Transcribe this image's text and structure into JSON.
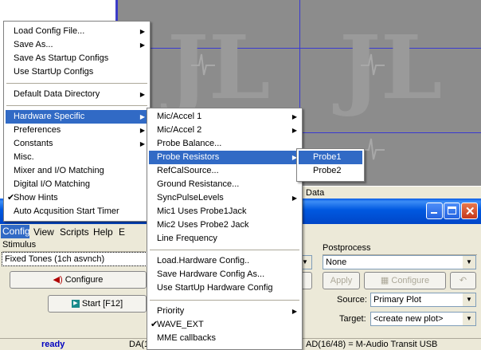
{
  "colors": {
    "menu_highlight": "#316ac5",
    "plot_bg": "#8c8c8c",
    "grid": "#3a3ad0",
    "xp_title": "#0058e0"
  },
  "plot": {
    "watermark": "JL"
  },
  "data_tab": {
    "label": "Data"
  },
  "window": {
    "controls": {
      "minimize": "minimize-icon",
      "maximize": "maximize-icon",
      "close": "close-icon"
    }
  },
  "menubar": {
    "items": [
      "Config",
      "View",
      "Scripts",
      "Help",
      "E"
    ]
  },
  "stimulus": {
    "label": "Stimulus",
    "value": "Fixed Tones (1ch asvnch)",
    "configure_label": "Configure",
    "start_label": "Start [F12]"
  },
  "postprocess": {
    "label": "Postprocess",
    "value": "None",
    "apply_label": "Apply",
    "configure_label": "Configure",
    "source_label": "Source:",
    "source_value": "Primary Plot",
    "target_label": "Target:",
    "target_value": "<create new plot>"
  },
  "status": {
    "ready": "ready",
    "da": "DA(1",
    "ad": "AD(16/48) = M-Audio Transit USB"
  },
  "config_menu": {
    "items": [
      {
        "label": "Load Config File...",
        "sub": true
      },
      {
        "label": "Save As...",
        "sub": true
      },
      {
        "label": "Save As Startup Configs"
      },
      {
        "label": "Use StartUp Configs"
      },
      {
        "label": "Default Data Directory",
        "sub": true
      },
      {
        "label": "Hardware Specific",
        "sub": true,
        "highlight": true
      },
      {
        "label": "Preferences",
        "sub": true
      },
      {
        "label": "Constants",
        "sub": true
      },
      {
        "label": "Misc."
      },
      {
        "label": "Mixer and I/O Matching"
      },
      {
        "label": "Digital I/O Matching"
      },
      {
        "label": "Show Hints",
        "checked": true
      },
      {
        "label": "Auto Acqusition Start Timer"
      }
    ]
  },
  "hardware_menu": {
    "items": [
      {
        "label": "Mic/Accel 1",
        "sub": true
      },
      {
        "label": "Mic/Accel 2",
        "sub": true
      },
      {
        "label": "Probe Balance..."
      },
      {
        "label": "Probe Resistors",
        "sub": true,
        "highlight": true
      },
      {
        "label": "RefCalSource..."
      },
      {
        "label": "Ground Resistance..."
      },
      {
        "label": "SyncPulseLevels",
        "sub": true
      },
      {
        "label": "Mic1 Uses Probe1Jack"
      },
      {
        "label": "Mic2 Uses Probe2 Jack"
      },
      {
        "label": "Line Frequency"
      },
      {
        "label": "Load.Hardware Config.."
      },
      {
        "label": "Save Hardware Config As..."
      },
      {
        "label": "Use StartUp Hardware Config"
      },
      {
        "label": "Priority",
        "sub": true
      },
      {
        "label": "WAVE_EXT",
        "checked": true
      },
      {
        "label": "MME callbacks"
      }
    ]
  },
  "probe_menu": {
    "items": [
      {
        "label": "Probe1",
        "highlight": true
      },
      {
        "label": "Probe2"
      }
    ]
  }
}
